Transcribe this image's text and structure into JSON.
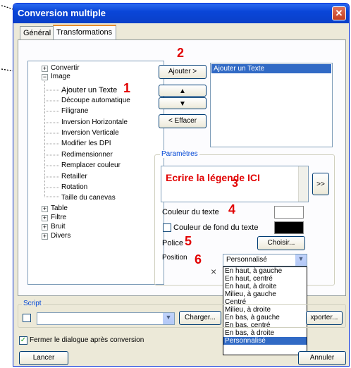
{
  "window": {
    "title": "Conversion multiple",
    "close": "✕"
  },
  "tabs": [
    "Général",
    "Transformations"
  ],
  "tree": [
    {
      "label": "Convertir",
      "exp": "+"
    },
    {
      "label": "Image",
      "exp": "−"
    },
    {
      "label": "Ajouter un Texte"
    },
    {
      "label": "Découpe automatique"
    },
    {
      "label": "Filigrane"
    },
    {
      "label": "Inversion Horizontale"
    },
    {
      "label": "Inversion Verticale"
    },
    {
      "label": "Modifier les DPI"
    },
    {
      "label": "Redimensionner"
    },
    {
      "label": "Remplacer couleur"
    },
    {
      "label": "Retailler"
    },
    {
      "label": "Rotation"
    },
    {
      "label": "Taille du canevas"
    },
    {
      "label": "Table",
      "exp": "+"
    },
    {
      "label": "Filtre",
      "exp": "+"
    },
    {
      "label": "Bruit",
      "exp": "+"
    },
    {
      "label": "Divers",
      "exp": "+"
    }
  ],
  "buttons": {
    "add": "Ajouter >",
    "up": "▲",
    "down": "▼",
    "clear": "< Effacer",
    "more": ">>",
    "choose": "Choisir...",
    "load": "Charger...",
    "export": "xporter...",
    "launch": "Lancer",
    "cancel": "Annuler"
  },
  "selected_list": [
    "Ajouter un Texte"
  ],
  "params": {
    "group_label": "Paramètres",
    "text_value": "Ecrire la légende ICI",
    "text_color_label": "Couleur du texte",
    "bg_color_label": "Couleur de fond du texte",
    "font_label": "Police",
    "position_label": "Position",
    "position_value": "Personnalisé",
    "position_options": [
      "En haut, à gauche",
      "En haut, centré",
      "En haut, à droite",
      "Milieu, à gauche",
      "Centré",
      "Milieu, à droite",
      "En bas, à gauche",
      "En bas, centré",
      "En bas, à droite",
      "Personnalisé"
    ],
    "x_mark": "×"
  },
  "script": {
    "group_label": "Script"
  },
  "close_after": "Fermer le dialogue après conversion",
  "annotations": [
    "1",
    "2",
    "3",
    "4",
    "5",
    "6"
  ],
  "colors": {
    "text_color": "#ffffff",
    "bg_color": "#000000",
    "annotation": "#e10000"
  }
}
